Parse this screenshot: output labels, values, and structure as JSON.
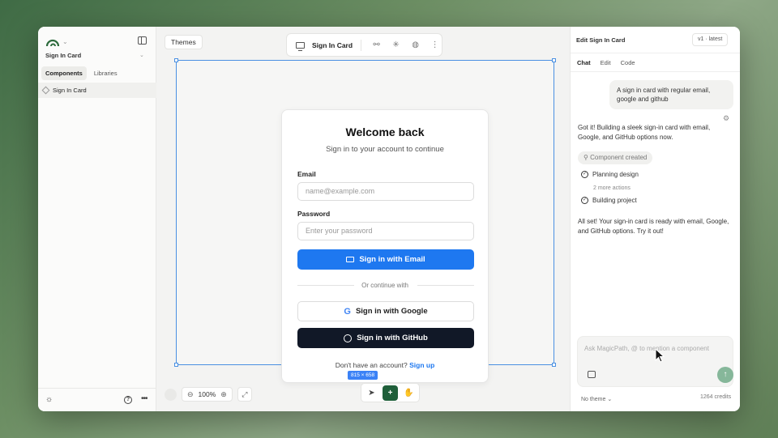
{
  "sidebar": {
    "project_name": "Sign In Card",
    "tabs": [
      "Components",
      "Libraries"
    ],
    "items": [
      {
        "label": "Sign In Card"
      }
    ]
  },
  "canvas": {
    "themes_label": "Themes",
    "toolbar_title": "Sign In Card",
    "size_badge": "815 × 658",
    "zoom": "100%"
  },
  "card": {
    "title": "Welcome back",
    "subtitle": "Sign in to your account to continue",
    "email_label": "Email",
    "email_placeholder": "name@example.com",
    "password_label": "Password",
    "password_placeholder": "Enter your password",
    "email_button": "Sign in with Email",
    "divider": "Or continue with",
    "google_button": "Sign in with Google",
    "github_button": "Sign in with GitHub",
    "signup_prompt": "Don't have an account?",
    "signup_link": "Sign up"
  },
  "panel": {
    "title": "Edit Sign In Card",
    "version": "v1 · latest",
    "tabs": [
      "Chat",
      "Edit",
      "Code"
    ],
    "user_message": "A sign in card with regular email, google and github",
    "reply_1": "Got it! Building a sleek sign-in card with email, Google, and GitHub options now.",
    "chip": "Component created",
    "steps": [
      "Planning design",
      "Building project"
    ],
    "more_actions": "2 more actions",
    "reply_2": "All set! Your sign-in card is ready with email, Google, and GitHub options. Try it out!",
    "ask_placeholder": "Ask MagicPath, @ to mention a component",
    "theme": "No theme",
    "credits": "1264 credits"
  },
  "colors": {
    "primary": "#1e78f0",
    "github": "#111827",
    "accent_green": "#1f5f3a",
    "selection": "#4a90e2"
  }
}
